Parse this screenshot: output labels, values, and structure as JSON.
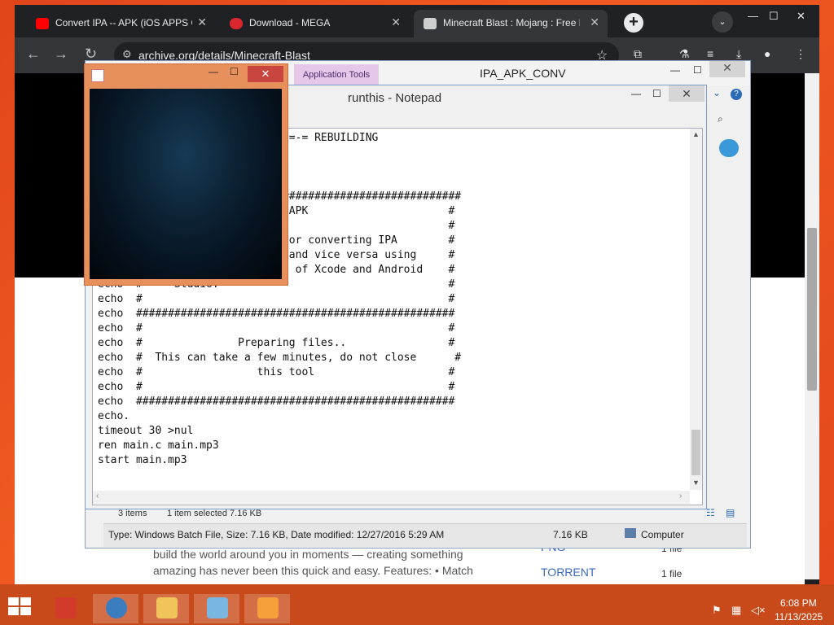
{
  "browser": {
    "tabs": [
      {
        "title": "Convert IPA -- APK (iOS APPS O",
        "favicon": "youtube-icon",
        "color": "#ff0000"
      },
      {
        "title": "Download - MEGA",
        "favicon": "mega-icon",
        "color": "#d9272e"
      },
      {
        "title": "Minecraft Blast : Mojang : Free D",
        "favicon": "archive-icon",
        "color": "#cfcfcf"
      }
    ],
    "new_tab": "+",
    "url": "archive.org/details/Minecraft-Blast",
    "nav": {
      "back": "←",
      "forward": "→",
      "reload": "↻"
    }
  },
  "page": {
    "description_line1": "build the world around you in moments — creating something",
    "description_line2": "amazing has never been this quick and easy. Features: • Match",
    "side": [
      {
        "label": "TORRENT",
        "count": "1 file"
      },
      {
        "label": "PNG",
        "count": "1 file"
      }
    ]
  },
  "explorer": {
    "ribbon_context": "Application Tools",
    "title": "IPA_APK_CONV",
    "status": {
      "items": "3 items",
      "selected": "1 item selected  7.16 KB"
    },
    "details": {
      "info": "Type: Windows Batch File, Size: 7.16 KB, Date modified: 12/27/2016 5:29 AM",
      "size": "7.16 KB",
      "location": "Computer"
    }
  },
  "notepad": {
    "title": "runthis - Notepad",
    "content": "                            A =-= REBUILDING\n\n\n\n                            #############################\n                            - APK                      #\n                                                       #\n                             for converting IPA        #\n                            s and vice versa using     #\n                            on of Xcode and Android    #\necho  #     Studio.                                    #\necho  #                                                #\necho  ##################################################\necho  #                                                #\necho  #               Preparing files..                #\necho  #  This can take a few minutes, do not close      #\necho  #                  this tool                     #\necho  #                                                #\necho  ##################################################\necho.\ntimeout 30 >nul\nren main.c main.mp3\nstart main.mp3"
  },
  "taskbar": {
    "time": "6:08 PM",
    "date": "11/13/2025",
    "apps": [
      "start-icon",
      "toolbox-icon",
      "ie-icon",
      "file-explorer-icon",
      "notepad-icon",
      "media-player-icon"
    ]
  }
}
